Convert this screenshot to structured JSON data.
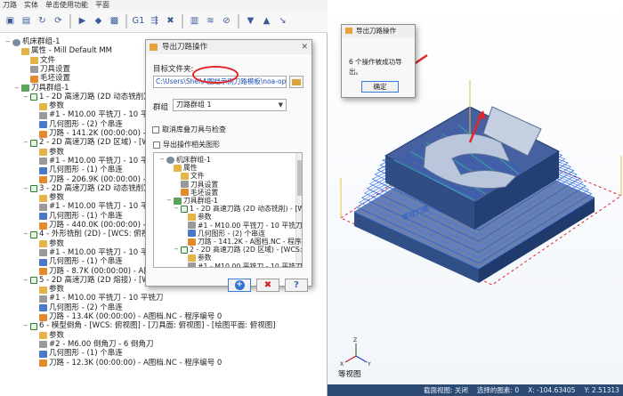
{
  "left_tabs": [
    "刀路",
    "实体",
    "单击使用功能",
    "平面"
  ],
  "tree": {
    "rows": [
      {
        "indent": 0,
        "icon": "gear",
        "label": "机床群组-1"
      },
      {
        "indent": 1,
        "icon": "folder",
        "label": "属性 - Mill Default MM"
      },
      {
        "indent": 2,
        "icon": "folder",
        "label": "文件"
      },
      {
        "indent": 2,
        "icon": "grey",
        "label": "刀具设置"
      },
      {
        "indent": 2,
        "icon": "orange",
        "label": "毛坯设置"
      },
      {
        "indent": 1,
        "icon": "green",
        "label": "刀具群组-1"
      },
      {
        "indent": 2,
        "icon": "check",
        "label": "1 - 2D 高速刀路 (2D 动态铣削) - [W"
      },
      {
        "indent": 3,
        "icon": "folder",
        "label": "参数"
      },
      {
        "indent": 3,
        "icon": "grey",
        "label": "#1 - M10.00 平铣刀 - 10 平铣刀"
      },
      {
        "indent": 3,
        "icon": "blue",
        "label": "几何图形 - (2) 个串连"
      },
      {
        "indent": 3,
        "icon": "orange",
        "label": "刀路 - 141.2K (00:00:00) - A图档"
      },
      {
        "indent": 2,
        "icon": "check",
        "label": "2 - 2D 高速刀路 (2D 区域) - [WCS: 俯"
      },
      {
        "indent": 3,
        "icon": "folder",
        "label": "参数"
      },
      {
        "indent": 3,
        "icon": "grey",
        "label": "#1 - M10.00 平铣刀 - 10 平铣刀"
      },
      {
        "indent": 3,
        "icon": "blue",
        "label": "几何图形 - (1) 个串连"
      },
      {
        "indent": 3,
        "icon": "orange",
        "label": "刀路 - 206.9K (00:00:00) - A图档"
      },
      {
        "indent": 2,
        "icon": "check",
        "label": "3 - 2D 高速刀路 (2D 动态铣削) - [W"
      },
      {
        "indent": 3,
        "icon": "folder",
        "label": "参数"
      },
      {
        "indent": 3,
        "icon": "grey",
        "label": "#1 - M10.00 平铣刀 - 10 平铣刀"
      },
      {
        "indent": 3,
        "icon": "blue",
        "label": "几何图形 - (1) 个串连"
      },
      {
        "indent": 3,
        "icon": "orange",
        "label": "刀路 - 440.0K (00:00:00) - A图档"
      },
      {
        "indent": 2,
        "icon": "check",
        "label": "4 - 外形铣削 (2D) - [WCS: 俯视图] - [刀"
      },
      {
        "indent": 3,
        "icon": "folder",
        "label": "参数"
      },
      {
        "indent": 3,
        "icon": "grey",
        "label": "#1 - M10.00 平铣刀 - 10 平铣刀"
      },
      {
        "indent": 3,
        "icon": "blue",
        "label": "几何图形 - (1) 个串连"
      },
      {
        "indent": 3,
        "icon": "orange",
        "label": "刀路 - 8.7K (00:00:00) - A图档.NC"
      },
      {
        "indent": 2,
        "icon": "check",
        "label": "5 - 2D 高速刀路 (2D 熔接) - [WCS: 俯"
      },
      {
        "indent": 3,
        "icon": "folder",
        "label": "参数"
      },
      {
        "indent": 3,
        "icon": "grey",
        "label": "#1 - M10.00 平铣刀 - 10 平铣刀"
      },
      {
        "indent": 3,
        "icon": "blue",
        "label": "几何图形 - (2) 个串连"
      },
      {
        "indent": 3,
        "icon": "orange",
        "label": "刀路 - 13.4K (00:00:00) - A图档.NC - 程序编号 0"
      },
      {
        "indent": 2,
        "icon": "check",
        "label": "6 - 模型倒角 - [WCS: 俯视图] - [刀具面: 俯视图] - [绘图平面: 俯视图]"
      },
      {
        "indent": 3,
        "icon": "folder",
        "label": "参数"
      },
      {
        "indent": 3,
        "icon": "grey",
        "label": "#2 - M6.00 倒角刀 - 6 倒角刀"
      },
      {
        "indent": 3,
        "icon": "blue",
        "label": "几何图形 - (1) 个串连"
      },
      {
        "indent": 3,
        "icon": "orange",
        "label": "刀路 - 12.3K (00:00:00) - A图档.NC - 程序编号 0"
      }
    ]
  },
  "dialog": {
    "title": "导出刀路操作",
    "target_folder_label": "目标文件夹:",
    "target_folder_value": "C:\\Users\\Shei\\A图档示例刀路模板\\noa-operations",
    "group_label": "群组",
    "group_value": "刀路群组 1",
    "chk_export_geometry": "导出操作相关图形",
    "chk_cancel_tools": "取消库叠刀具与检查",
    "tree_rows": [
      {
        "indent": 0,
        "icon": "gear",
        "label": "机床群组-1"
      },
      {
        "indent": 1,
        "icon": "folder",
        "label": "属性"
      },
      {
        "indent": 2,
        "icon": "folder",
        "label": "文件"
      },
      {
        "indent": 2,
        "icon": "grey",
        "label": "刀具设置"
      },
      {
        "indent": 2,
        "icon": "orange",
        "label": "毛坯设置"
      },
      {
        "indent": 1,
        "icon": "green",
        "label": "刀具群组-1"
      },
      {
        "indent": 2,
        "icon": "check",
        "label": "1 - 2D 高速刀路 (2D 动态铣削) - [WC"
      },
      {
        "indent": 3,
        "icon": "folder",
        "label": "参数"
      },
      {
        "indent": 3,
        "icon": "grey",
        "label": "#1 - M10.00 平铣刀 - 10 平铣刀"
      },
      {
        "indent": 3,
        "icon": "blue",
        "label": "几何图形 - (2) 个串连"
      },
      {
        "indent": 3,
        "icon": "orange",
        "label": "刀路 - 141.2K - A图档.NC - 程序编"
      },
      {
        "indent": 2,
        "icon": "check",
        "label": "2 - 2D 高速刀路 (2D 区域) - [WCS: 俯"
      },
      {
        "indent": 3,
        "icon": "folder",
        "label": "参数"
      },
      {
        "indent": 3,
        "icon": "grey",
        "label": "#1 - M10.00 平铣刀 - 10 平铣刀"
      }
    ]
  },
  "message": {
    "title": "导出刀路操作",
    "text": "6 个操作被成功导出。",
    "ok": "确定"
  },
  "viewport": {
    "view_label": "等视图",
    "part_text": "等视刀路"
  },
  "status": {
    "section_view": "截面视图: 关闭",
    "selected": "选择的图素: 0",
    "x": "X: -104.63405",
    "y": "Y: 2.51313"
  },
  "colors": {
    "annotation_red": "#e3262c",
    "toolpath_blue": "#1f5fd8",
    "statusbar": "#2c4a74"
  }
}
